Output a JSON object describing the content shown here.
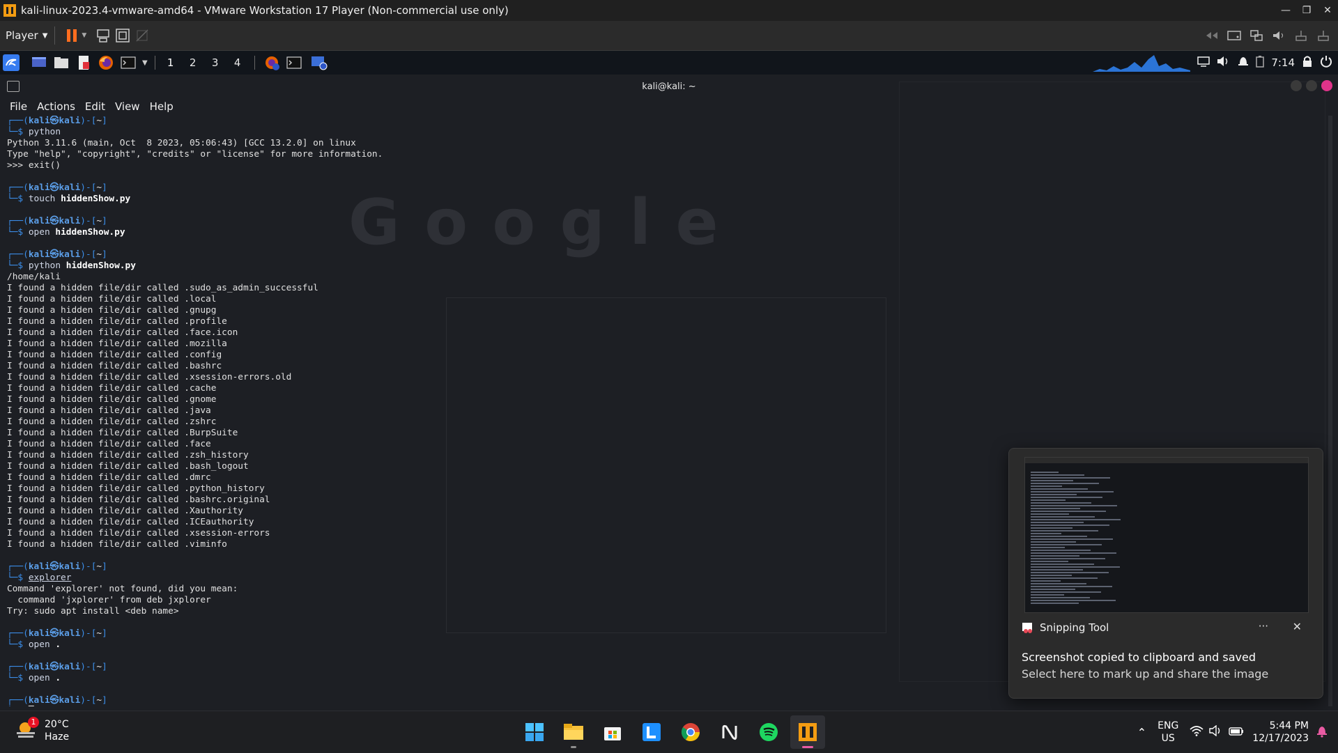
{
  "vm_window": {
    "title": "kali-linux-2023.4-vmware-amd64 - VMware Workstation 17 Player (Non-commercial use only)",
    "player_label": "Player"
  },
  "kali_panel": {
    "workspaces": [
      "1",
      "2",
      "3",
      "4"
    ],
    "clock": "7:14"
  },
  "terminal": {
    "window_title": "kali@kali: ~",
    "menu": [
      "File",
      "Actions",
      "Edit",
      "View",
      "Help"
    ],
    "prompt_user": "kali",
    "prompt_host": "kali",
    "prompt_dir": "~",
    "blocks": [
      {
        "command": "python",
        "output": [
          "Python 3.11.6 (main, Oct  8 2023, 05:06:43) [GCC 13.2.0] on linux",
          "Type \"help\", \"copyright\", \"credits\" or \"license\" for more information.",
          ">>> exit()"
        ]
      },
      {
        "command": "touch hiddenShow.py",
        "output": []
      },
      {
        "command": "open hiddenShow.py",
        "output": []
      },
      {
        "command": "python hiddenShow.py",
        "output": [
          "/home/kali",
          "I found a hidden file/dir called .sudo_as_admin_successful",
          "I found a hidden file/dir called .local",
          "I found a hidden file/dir called .gnupg",
          "I found a hidden file/dir called .profile",
          "I found a hidden file/dir called .face.icon",
          "I found a hidden file/dir called .mozilla",
          "I found a hidden file/dir called .config",
          "I found a hidden file/dir called .bashrc",
          "I found a hidden file/dir called .xsession-errors.old",
          "I found a hidden file/dir called .cache",
          "I found a hidden file/dir called .gnome",
          "I found a hidden file/dir called .java",
          "I found a hidden file/dir called .zshrc",
          "I found a hidden file/dir called .BurpSuite",
          "I found a hidden file/dir called .face",
          "I found a hidden file/dir called .zsh_history",
          "I found a hidden file/dir called .bash_logout",
          "I found a hidden file/dir called .dmrc",
          "I found a hidden file/dir called .python_history",
          "I found a hidden file/dir called .bashrc.original",
          "I found a hidden file/dir called .Xauthority",
          "I found a hidden file/dir called .ICEauthority",
          "I found a hidden file/dir called .xsession-errors",
          "I found a hidden file/dir called .viminfo"
        ]
      },
      {
        "command": "explorer",
        "output": [
          "Command 'explorer' not found, did you mean:",
          "  command 'jxplorer' from deb jxplorer",
          "Try: sudo apt install <deb name>"
        ]
      },
      {
        "command": "open .",
        "output": []
      },
      {
        "command": "open .",
        "output": []
      },
      {
        "command": "",
        "output": []
      }
    ]
  },
  "notification": {
    "app_name": "Snipping Tool",
    "more_label": "···",
    "close_label": "✕",
    "title": "Screenshot copied to clipboard and saved",
    "body": "Select here to mark up and share the image"
  },
  "windows_taskbar": {
    "weather_temp": "20°C",
    "weather_desc": "Haze",
    "weather_badge": "1",
    "apps": [
      "start-icon",
      "file-explorer-icon",
      "microsoft-store-icon",
      "l-app-icon",
      "chrome-icon",
      "notion-icon",
      "spotify-icon",
      "vmware-icon"
    ],
    "lang_primary": "ENG",
    "lang_secondary": "US",
    "time": "5:44 PM",
    "date": "12/17/2023"
  },
  "colors": {
    "prompt_blue": "#3b8eea",
    "vmware_accent": "#f39c12",
    "pause_orange": "#ff6d1f",
    "taskbar_active": "#e95ba3"
  }
}
